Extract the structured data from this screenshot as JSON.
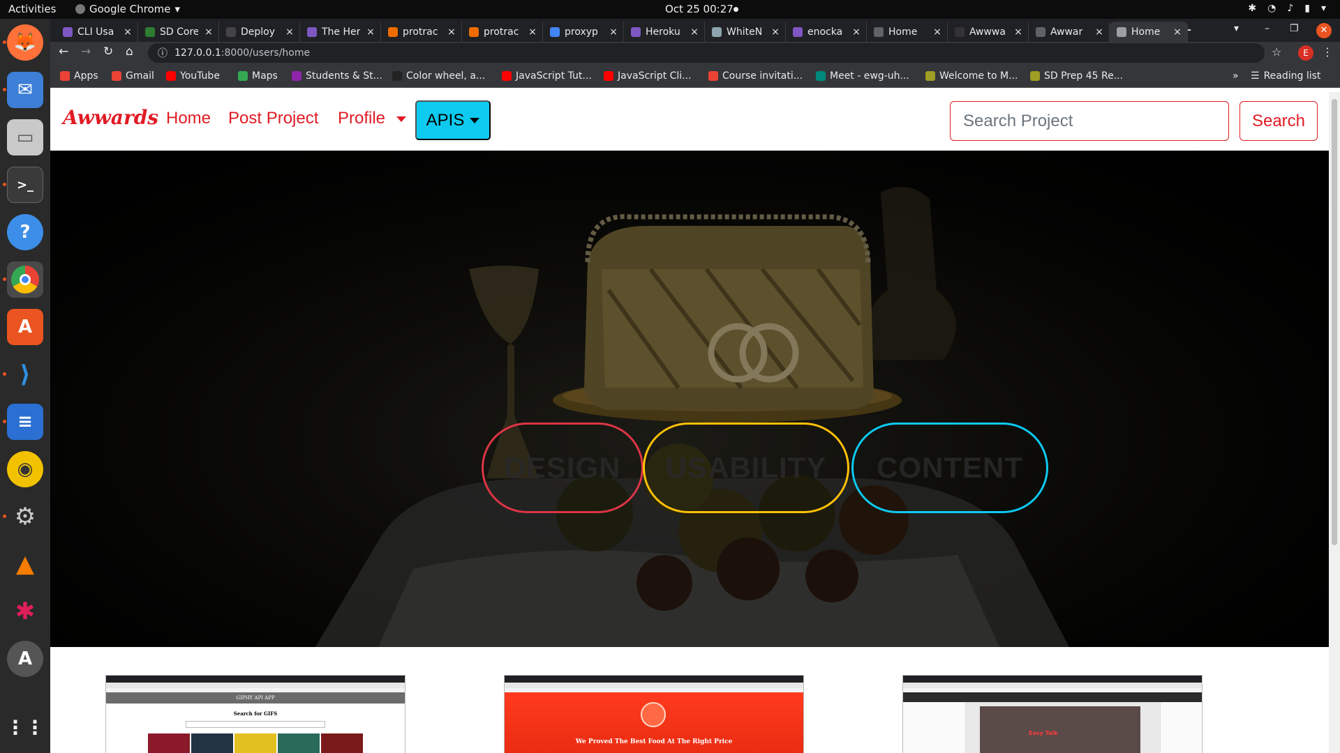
{
  "system": {
    "activities": "Activities",
    "app_name": "Google Chrome",
    "clock": "Oct 25  00:27"
  },
  "tabs": [
    {
      "title": "CLI Usa",
      "color": "#7e57c2",
      "close": "×"
    },
    {
      "title": "SD Core",
      "color": "#2e7d32",
      "close": "×"
    },
    {
      "title": "Deploy",
      "color": "#444444",
      "close": "×"
    },
    {
      "title": "The Her",
      "color": "#7e57c2",
      "close": "×"
    },
    {
      "title": "protrac",
      "color": "#ef6c00",
      "close": "×"
    },
    {
      "title": "protrac",
      "color": "#ef6c00",
      "close": "×"
    },
    {
      "title": "proxyp",
      "color": "#4285f4",
      "close": "×"
    },
    {
      "title": "Heroku",
      "color": "#7e57c2",
      "close": "×"
    },
    {
      "title": "WhiteN",
      "color": "#90a4ae",
      "close": "×"
    },
    {
      "title": "enocka",
      "color": "#7e57c2",
      "close": "×"
    },
    {
      "title": "Home",
      "color": "#5f6368",
      "close": "×"
    },
    {
      "title": "Awwwa",
      "color": "#333333",
      "close": "×"
    },
    {
      "title": "Awwar",
      "color": "#5f6368",
      "close": "×"
    },
    {
      "title": "Home",
      "color": "#9aa0a6",
      "close": "×",
      "active": true
    }
  ],
  "new_tab": "+",
  "address": {
    "host": "127.0.0.1",
    "path": ":8000/users/home"
  },
  "bookmarks": [
    {
      "label": "Apps",
      "color": "#ea4335"
    },
    {
      "label": "Gmail",
      "color": "#ea4335"
    },
    {
      "label": "YouTube",
      "color": "#ff0000"
    },
    {
      "label": "Maps",
      "color": "#34a853"
    },
    {
      "label": "Students & St...",
      "color": "#8e24aa"
    },
    {
      "label": "Color wheel, a...",
      "color": "#222222"
    },
    {
      "label": "JavaScript Tut...",
      "color": "#ff0000"
    },
    {
      "label": "JavaScript Cli...",
      "color": "#ff0000"
    },
    {
      "label": "Course invitati...",
      "color": "#ea4335"
    },
    {
      "label": "Meet - ewg-uh...",
      "color": "#00897b"
    },
    {
      "label": "Welcome to M...",
      "color": "#9e9d24"
    },
    {
      "label": "SD Prep 45 Re...",
      "color": "#9e9d24"
    }
  ],
  "reading_list": "Reading list",
  "avatar_letter": "E",
  "site": {
    "brand": "Awwards",
    "nav": {
      "home": "Home",
      "post_project": "Post Project",
      "profile": "Profile",
      "apis": "APIS"
    },
    "search_placeholder": "Search Project",
    "search_button": "Search",
    "hero_pills": [
      {
        "label": "DESIGN",
        "color": "#dc3545"
      },
      {
        "label": "USABILITY",
        "color": "#ffc107"
      },
      {
        "label": "CONTENT",
        "color": "#0dcaf0"
      }
    ]
  },
  "project_cards": [
    {
      "name": "GIPHY API APP",
      "subtitle": "Search for GIFS"
    },
    {
      "name": "We Proved The Best Food At The Right Price"
    },
    {
      "name": "Easy Talk"
    }
  ]
}
